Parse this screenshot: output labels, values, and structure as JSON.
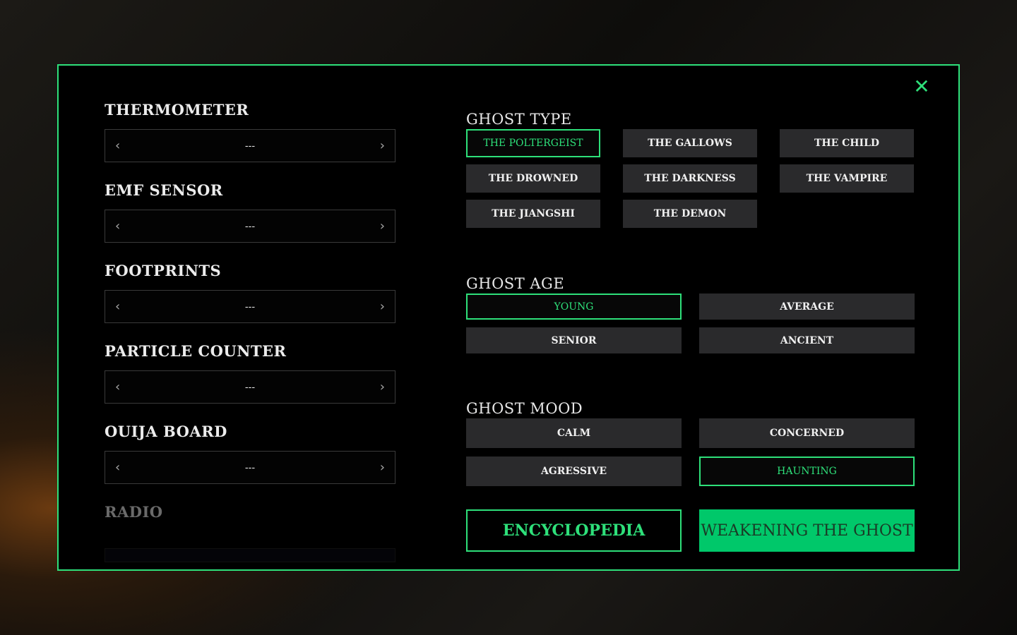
{
  "close_icon": "close-icon",
  "accent": "#2ee07a",
  "evidence": [
    {
      "label": "THERMOMETER",
      "value": "---"
    },
    {
      "label": "EMF SENSOR",
      "value": "---"
    },
    {
      "label": "FOOTPRINTS",
      "value": "---"
    },
    {
      "label": "PARTICLE COUNTER",
      "value": "---"
    },
    {
      "label": "OUIJA BOARD",
      "value": "---"
    },
    {
      "label": "RADIO",
      "value": ""
    }
  ],
  "ghost_type": {
    "title": "GHOST TYPE",
    "options": [
      "THE POLTERGEIST",
      "THE GALLOWS",
      "THE CHILD",
      "THE DROWNED",
      "THE DARKNESS",
      "THE VAMPIRE",
      "THE JIANGSHI",
      "THE DEMON"
    ],
    "selected": "THE POLTERGEIST"
  },
  "ghost_age": {
    "title": "GHOST AGE",
    "options": [
      "YOUNG",
      "AVERAGE",
      "SENIOR",
      "ANCIENT"
    ],
    "selected": "YOUNG"
  },
  "ghost_mood": {
    "title": "GHOST MOOD",
    "options": [
      "CALM",
      "CONCERNED",
      "AGRESSIVE",
      "HAUNTING"
    ],
    "selected": "HAUNTING"
  },
  "encyclopedia_label": "ENCYCLOPEDIA",
  "weakening_label": "WEAKENING THE GHOST"
}
